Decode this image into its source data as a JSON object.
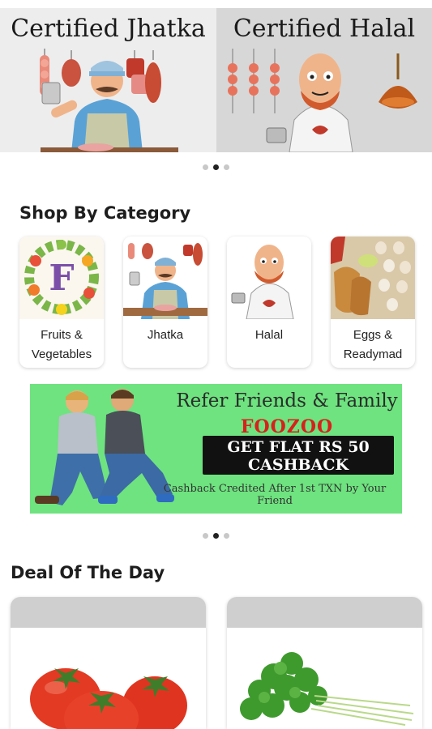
{
  "banners": [
    {
      "title": "Certified Jhatka"
    },
    {
      "title": "Certified Halal"
    }
  ],
  "top_carousel": {
    "count": 3,
    "active": 2
  },
  "category_section": {
    "title": "Shop By Category"
  },
  "categories": [
    {
      "label": "Fruits &\nVegetables",
      "image": "fruits-vegetables-image"
    },
    {
      "label": "Jhatka",
      "image": "butcher-image"
    },
    {
      "label": "Halal",
      "image": "halal-butcher-image"
    },
    {
      "label": "Eggs &\nReadymad",
      "image": "eggs-readymade-image"
    }
  ],
  "refer_banner": {
    "title": "Refer Friends & Family",
    "brand": "FOOZOO",
    "offer_line1": "GET FLAT RS 50",
    "offer_line2": "CASHBACK",
    "note": "Cashback Credited After 1st TXN by Your Friend"
  },
  "promo_carousel": {
    "count": 3,
    "active": 2
  },
  "deal_section": {
    "title": "Deal Of The Day"
  },
  "deals": [
    {
      "image": "tomatoes-image"
    },
    {
      "image": "coriander-image"
    }
  ],
  "colors": {
    "refer_bg": "#6ee37f",
    "brand_red": "#d8201c",
    "dot_active": "#222222",
    "dot_inactive": "#c8c8c8"
  }
}
